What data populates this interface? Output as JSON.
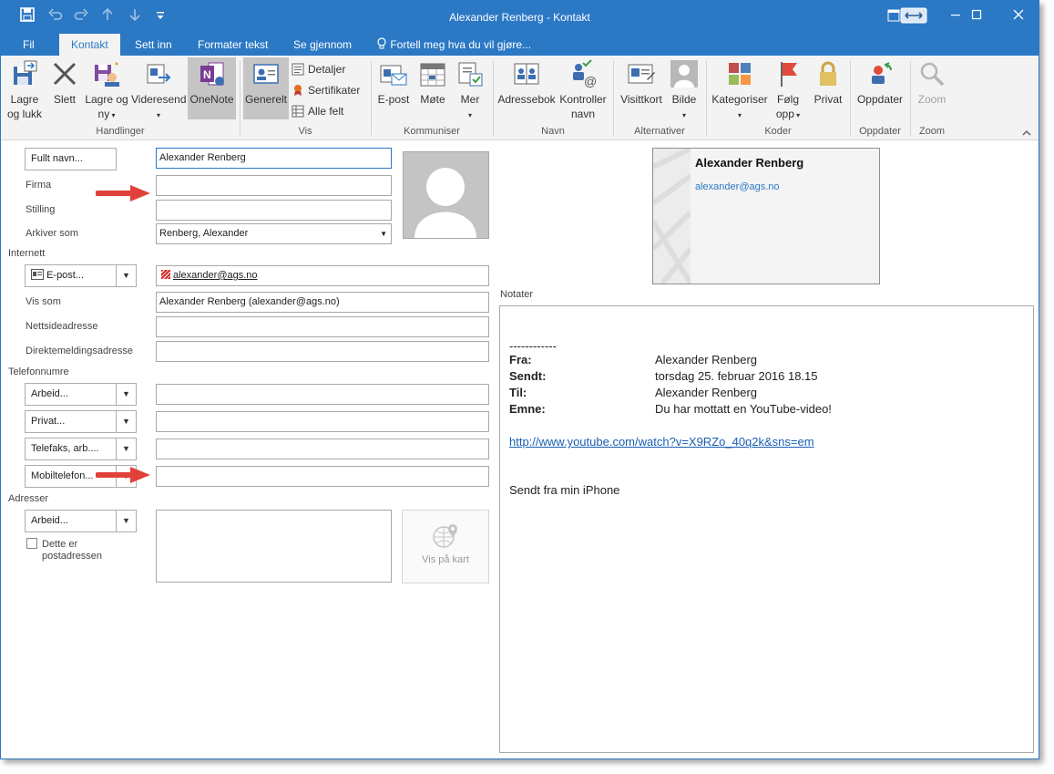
{
  "window": {
    "title": "Alexander Renberg - Kontakt",
    "accent": "#2b78c5"
  },
  "quick_access": {
    "icons": [
      "save-icon",
      "undo-icon",
      "redo-icon",
      "up-arrow-icon",
      "down-arrow-icon",
      "customize-icon"
    ]
  },
  "tabs": [
    {
      "label": "Fil"
    },
    {
      "label": "Kontakt"
    },
    {
      "label": "Sett inn"
    },
    {
      "label": "Formater tekst"
    },
    {
      "label": "Se gjennom"
    },
    {
      "label": "Fortell meg hva du vil gjøre..."
    }
  ],
  "ribbon": {
    "handlinger": {
      "label": "Handlinger",
      "save_close": [
        "Lagre",
        "og lukk"
      ],
      "delete": "Slett",
      "save_new": [
        "Lagre og",
        "ny"
      ],
      "forward": "Videresend",
      "onenote": "OneNote"
    },
    "vis": {
      "label": "Vis",
      "general": "Generelt",
      "details": "Detaljer",
      "certificates": "Sertifikater",
      "all_fields": "Alle felt"
    },
    "kommuniser": {
      "label": "Kommuniser",
      "email": "E-post",
      "meeting": "Møte",
      "more": "Mer"
    },
    "navn": {
      "label": "Navn",
      "address_book": "Adressebok",
      "check_names": [
        "Kontroller",
        "navn"
      ]
    },
    "alternativer": {
      "label": "Alternativer",
      "business_card": "Visittkort",
      "picture": "Bilde"
    },
    "koder": {
      "label": "Koder",
      "categorize": "Kategoriser",
      "follow_up": [
        "Følg",
        "opp"
      ],
      "private": "Privat"
    },
    "oppdater": {
      "label": "Oppdater",
      "update": "Oppdater"
    },
    "zoom": {
      "label": "Zoom",
      "zoom": "Zoom"
    }
  },
  "form": {
    "full_name_button": "Fullt navn...",
    "full_name_value": "Alexander Renberg",
    "company_label": "Firma",
    "company_value": "",
    "job_title_label": "Stilling",
    "job_title_value": "",
    "file_as_label": "Arkiver som",
    "file_as_value": "Renberg, Alexander",
    "internet_section": "Internett",
    "email_button": "E-post...",
    "email_value": "alexander@ags.no",
    "display_as_label": "Vis som",
    "display_as_value": "Alexander Renberg (alexander@ags.no)",
    "web_page_label": "Nettsideadresse",
    "web_page_value": "",
    "im_label": "Direktemeldingsadresse",
    "im_value": "",
    "phone_section": "Telefonnumre",
    "phones": [
      {
        "label": "Arbeid...",
        "value": ""
      },
      {
        "label": "Privat...",
        "value": ""
      },
      {
        "label": "Telefaks, arb....",
        "value": ""
      },
      {
        "label": "Mobiltelefon...",
        "value": ""
      }
    ],
    "address_section": "Adresser",
    "address_button": "Arbeid...",
    "address_value": "",
    "mailing_checkbox": [
      "Dette er",
      "postadressen"
    ],
    "mailing_checked": false,
    "map_button": "Vis på kart"
  },
  "business_card": {
    "name": "Alexander Renberg",
    "email": "alexander@ags.no"
  },
  "notes": {
    "label": "Notater",
    "separator": "------------",
    "from_key": "Fra:",
    "from_value": "Alexander Renberg",
    "sent_key": "Sendt:",
    "sent_value": "torsdag 25. februar 2016 18.15",
    "to_key": "Til:",
    "to_value": "Alexander Renberg",
    "subject_key": "Emne:",
    "subject_value": "Du har mottatt en YouTube-video!",
    "link": "http://www.youtube.com/watch?v=X9RZo_40q2k&sns=em",
    "signature": "Sendt fra min iPhone"
  },
  "colors": {
    "title_bar": "#2b78c5",
    "ribbon_bg": "#f3f3f3",
    "arrow": "#e0413a",
    "link": "#1a5fb4"
  }
}
